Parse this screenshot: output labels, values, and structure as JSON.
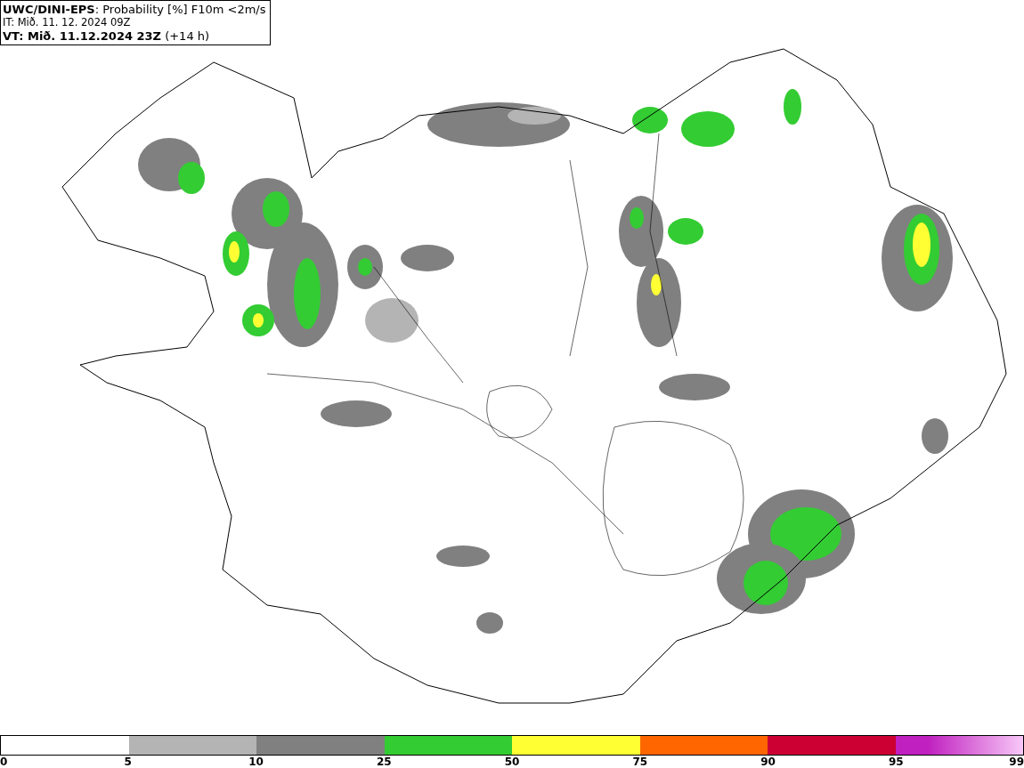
{
  "header": {
    "title": "**UWC/DINI-EPS**: Probability [%] F10m <2m/s",
    "issue_time": "IT: Mið. 11. 12. 2024 09Z",
    "valid_time": "**VT: Mið. 11.12.2024 23Z** (+14 h)"
  },
  "legend": {
    "segments": [
      {
        "color": "#b4b4b4"
      },
      {
        "color": "#808080"
      },
      {
        "color": "#33cc33"
      },
      {
        "color": "#ffff33"
      },
      {
        "color": "#ff6600"
      },
      {
        "color": "#cc0033"
      },
      {
        "color": "#c020c0"
      }
    ],
    "ticks": [
      "0",
      "5",
      "10",
      "25",
      "50",
      "75",
      "90",
      "95",
      "99"
    ]
  }
}
